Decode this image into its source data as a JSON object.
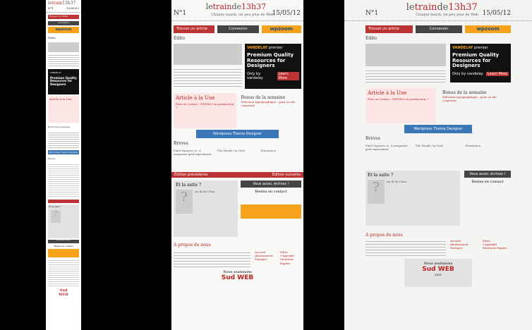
{
  "site": {
    "logo_prefix": "le",
    "logo_main": "train",
    "logo_suffix": "de",
    "logo_time": "13h37",
    "tagline": "Chaque mardi, un peu plus de Web",
    "number": "N°1",
    "date": "15/05/12"
  },
  "nav": {
    "search_label": "Trouver un article",
    "login_label": "Connexion",
    "login_sub": "Newsletter / RSS",
    "ad_logo": "wpzoom"
  },
  "edito": {
    "title": "Edito"
  },
  "ad": {
    "brand": "VANDELAY",
    "brand_tag": "premier",
    "headline": "Premium Quality Resources for Designers",
    "sub": "Only by vandelay",
    "cta": "Learn More",
    "caption": "Annonce ordinaire"
  },
  "une": {
    "title": "Article à la Une",
    "link": "Pour ou Contre : l'HTML5 en production ?"
  },
  "bonus": {
    "title": "Bonus de la semaine",
    "link": "Sélection typographique : pour ou ide corporate"
  },
  "wp_banner": "Wordpress Theme Designer",
  "breves": {
    "title": "Brèves",
    "items": [
      {
        "title": "Pixel Squares vs. A magazine grid experiment"
      },
      {
        "title": "The Heads Up Grid"
      },
      {
        "title": "Prismatica"
      }
    ]
  },
  "pager": {
    "prev": "Édition précédente",
    "next": "Édition suivante"
  },
  "suite": {
    "title": "Et la suite ?",
    "author": "Au fil de l'Eau"
  },
  "write": {
    "label": "Vous aussi, écrivez !"
  },
  "contact": {
    "title": "Restez en contact"
  },
  "about": {
    "title": "A propos de nous",
    "links_a": [
      "Accueil",
      "Abonnement",
      "Partager",
      "Conseils",
      "Outils"
    ],
    "links_b": [
      "Edito",
      "Copyright",
      "Mentions légales",
      "C.G.V",
      "Plan du site"
    ]
  },
  "sponsor": {
    "title": "Nous soutenons",
    "name": "Sud WEB",
    "year": "2011"
  },
  "colors": {
    "accent": "#b33333",
    "orange": "#f7a21b",
    "dark": "#444444"
  }
}
